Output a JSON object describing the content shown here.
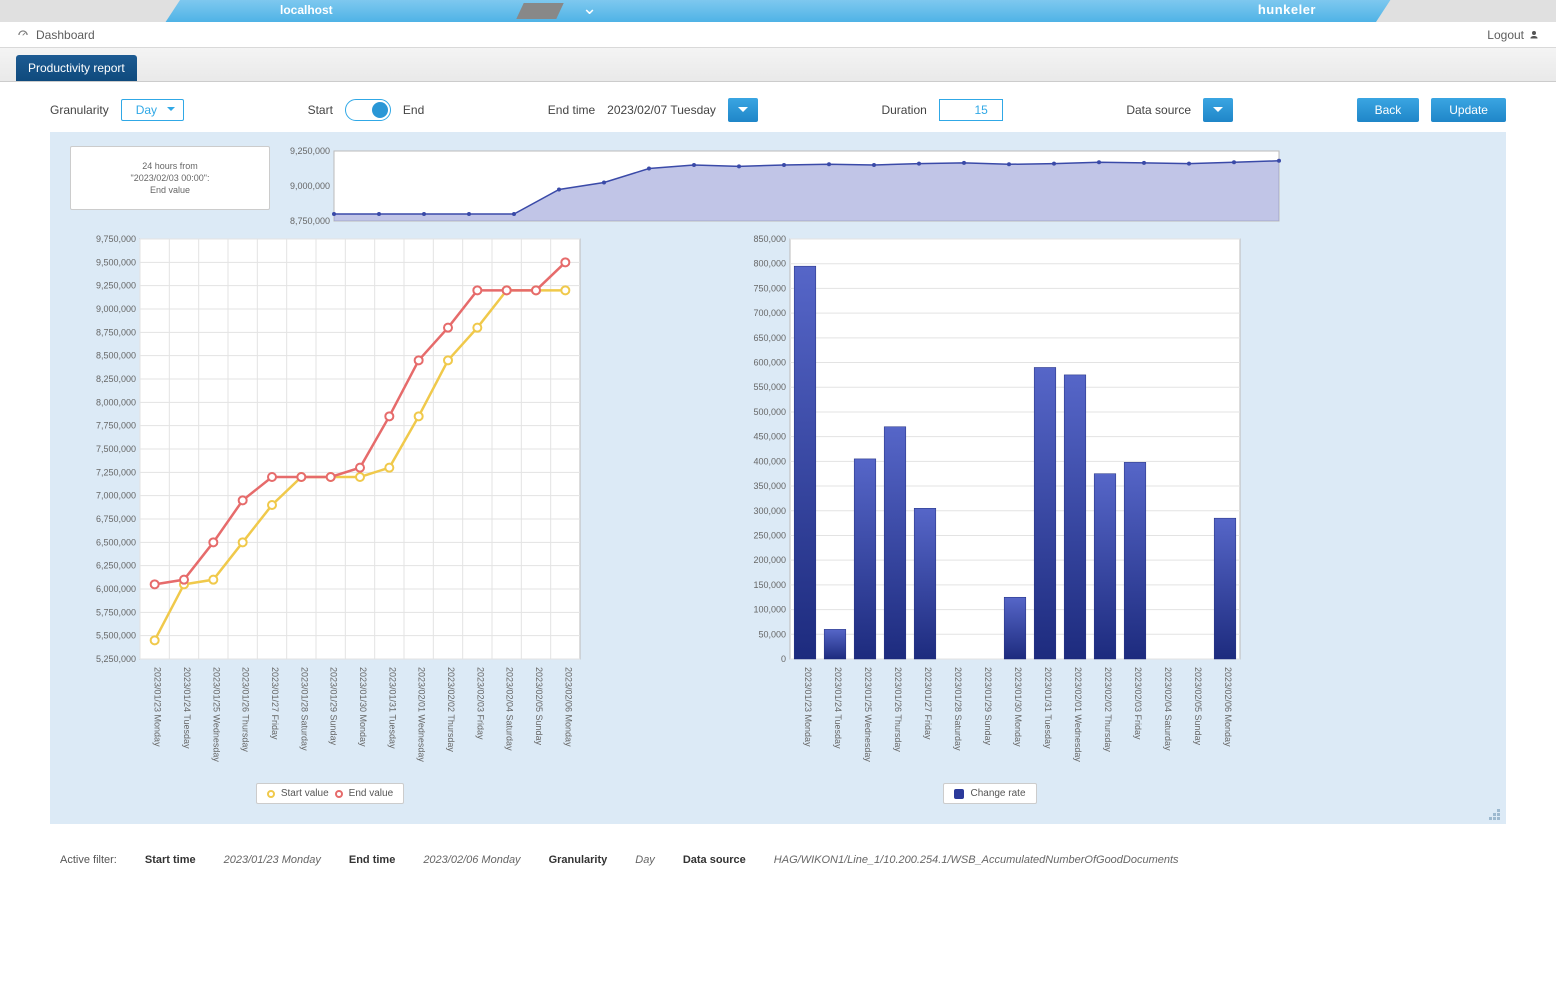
{
  "header": {
    "host_label": "localhost",
    "brand": "hunkeler",
    "dashboard_label": "Dashboard",
    "logout_label": "Logout"
  },
  "tab": {
    "title": "Productivity report"
  },
  "controls": {
    "granularity_label": "Granularity",
    "granularity_value": "Day",
    "start_label": "Start",
    "end_label": "End",
    "end_time_label": "End time",
    "end_time_value": "2023/02/07 Tuesday",
    "duration_label": "Duration",
    "duration_value": "15",
    "datasource_label": "Data source",
    "back_label": "Back",
    "update_label": "Update"
  },
  "info_box": {
    "line1": "24 hours from",
    "line2": "\"2023/02/03 00:00\":",
    "line3": "End value"
  },
  "legend_left": {
    "a": "Start value",
    "b": "End value"
  },
  "legend_right": {
    "a": "Change rate"
  },
  "footer": {
    "active_filter_label": "Active filter:",
    "start_time_label": "Start time",
    "start_time_value": "2023/01/23 Monday",
    "end_time_label": "End time",
    "end_time_value": "2023/02/06 Monday",
    "granularity_label": "Granularity",
    "granularity_value": "Day",
    "datasource_label": "Data source",
    "datasource_value": "HAG/WIKON1/Line_1/10.200.254.1/WSB_AccumulatedNumberOfGoodDocuments"
  },
  "chart_data": [
    {
      "id": "overview",
      "type": "area-line",
      "y_ticks": [
        8750000,
        9000000,
        9250000
      ],
      "x": [
        "2023/01/23",
        "2023/01/24",
        "2023/01/25",
        "2023/01/26",
        "2023/01/27",
        "2023/01/28",
        "2023/01/29",
        "2023/01/30",
        "2023/01/31",
        "2023/02/01",
        "2023/02/02",
        "2023/02/03",
        "2023/02/04",
        "2023/02/05",
        "2023/02/06"
      ],
      "values": [
        8800000,
        8800000,
        8800000,
        8800000,
        8800000,
        8975000,
        9025000,
        9125000,
        9150000,
        9140000,
        9150000,
        9155000,
        9150000,
        9160000,
        9165000,
        9155000,
        9160000,
        9170000,
        9165000,
        9160000,
        9170000,
        9180000
      ]
    },
    {
      "id": "start_end",
      "type": "line",
      "categories": [
        "2023/01/23 Monday",
        "2023/01/24 Tuesday",
        "2023/01/25 Wednesday",
        "2023/01/26 Thursday",
        "2023/01/27 Friday",
        "2023/01/28 Saturday",
        "2023/01/29 Sunday",
        "2023/01/30 Monday",
        "2023/01/31 Tuesday",
        "2023/02/01 Wednesday",
        "2023/02/02 Thursday",
        "2023/02/03 Friday",
        "2023/02/04 Saturday",
        "2023/02/05 Sunday",
        "2023/02/06 Monday"
      ],
      "y_ticks": [
        5250000,
        5500000,
        5750000,
        6000000,
        6250000,
        6500000,
        6750000,
        7000000,
        7250000,
        7500000,
        7750000,
        8000000,
        8250000,
        8500000,
        8750000,
        9000000,
        9250000,
        9500000,
        9750000
      ],
      "series": [
        {
          "name": "Start value",
          "color": "#f0c94b",
          "values": [
            5450000,
            6050000,
            6100000,
            6500000,
            6900000,
            7200000,
            7200000,
            7200000,
            7300000,
            7850000,
            8450000,
            8800000,
            9200000,
            9200000,
            9200000
          ]
        },
        {
          "name": "End value",
          "color": "#e66b6b",
          "values": [
            6050000,
            6100000,
            6500000,
            6950000,
            7200000,
            7200000,
            7200000,
            7300000,
            7850000,
            8450000,
            8800000,
            9200000,
            9200000,
            9200000,
            9500000
          ]
        }
      ]
    },
    {
      "id": "change_rate",
      "type": "bar",
      "categories": [
        "2023/01/23 Monday",
        "2023/01/24 Tuesday",
        "2023/01/25 Wednesday",
        "2023/01/26 Thursday",
        "2023/01/27 Friday",
        "2023/01/28 Saturday",
        "2023/01/29 Sunday",
        "2023/01/30 Monday",
        "2023/01/31 Tuesday",
        "2023/02/01 Wednesday",
        "2023/02/02 Thursday",
        "2023/02/03 Friday",
        "2023/02/04 Saturday",
        "2023/02/05 Sunday",
        "2023/02/06 Monday"
      ],
      "y_ticks": [
        0,
        50000,
        100000,
        150000,
        200000,
        250000,
        300000,
        350000,
        400000,
        450000,
        500000,
        550000,
        600000,
        650000,
        700000,
        750000,
        800000,
        850000
      ],
      "values": [
        795000,
        60000,
        405000,
        470000,
        305000,
        0,
        0,
        125000,
        590000,
        575000,
        375000,
        398000,
        0,
        0,
        285000
      ],
      "color": "#2b3a9b"
    }
  ]
}
